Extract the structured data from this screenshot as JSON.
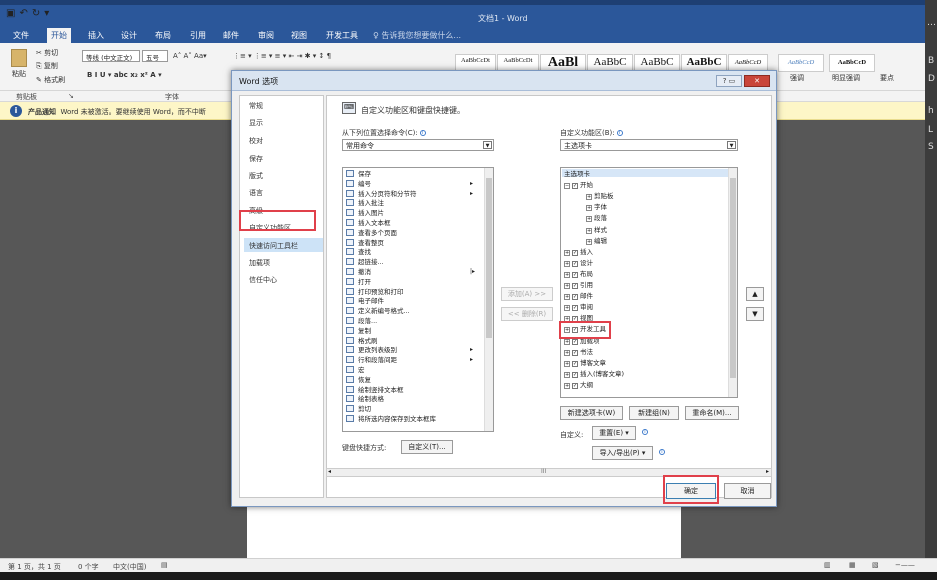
{
  "word": {
    "title": "文档1 - Word",
    "tabs": [
      "文件",
      "开始",
      "插入",
      "设计",
      "布局",
      "引用",
      "邮件",
      "审阅",
      "视图",
      "开发工具"
    ],
    "tell_me": "告诉我您想要做什么...",
    "clipboard": {
      "paste": "粘贴",
      "cut": "剪切",
      "copy": "复制",
      "format_painter": "格式刷"
    },
    "font_name": "等线 (中文正文)",
    "font_size": "五号",
    "styles": [
      "AaBbCcDt",
      "AaBbCcDt",
      "AaBl",
      "AaBbC",
      "AaBbC",
      "AaBbC",
      "AaBbCcD",
      "AaBbCcD",
      "AaBbCcD"
    ],
    "style_names": [
      "强调",
      "明显强调",
      "要点"
    ],
    "group_labels": [
      "剪贴板",
      "字体"
    ],
    "notice": {
      "label": "产品通知",
      "text": "Word 未被激活。要继续使用 Word，而不中断"
    },
    "status": {
      "page": "第 1 页，共 1 页",
      "words": "0 个字",
      "lang": "中文(中国)"
    },
    "right_panel": [
      "…",
      "B",
      "D",
      "h",
      "L",
      "S"
    ]
  },
  "dialog": {
    "title": "Word 选项",
    "nav": [
      "常规",
      "显示",
      "校对",
      "保存",
      "版式",
      "语言",
      "高级",
      "自定义功能区",
      "快速访问工具栏",
      "加载项",
      "信任中心"
    ],
    "selected_nav": "自定义功能区",
    "header": "自定义功能区和键盘快捷键。",
    "left_label": "从下列位置选择命令(C):",
    "left_select": "常用命令",
    "right_label": "自定义功能区(B):",
    "right_select": "主选项卡",
    "commands": [
      "保存",
      "编号",
      "插入分页符和分节符",
      "插入批注",
      "插入图片",
      "插入文本框",
      "查看多个页面",
      "查看整页",
      "查找",
      "超链接...",
      "撤消",
      "打开",
      "打印预览和打印",
      "电子邮件",
      "定义新编号格式...",
      "段落...",
      "复制",
      "格式刷",
      "更改列表级别",
      "行和段落间距",
      "宏",
      "恢复",
      "绘制竖排文本框",
      "绘制表格",
      "剪切",
      "将所选内容保存到文本框库"
    ],
    "tree": [
      {
        "pm": "⊟",
        "check": true,
        "label": "主选项卡",
        "root": true
      },
      {
        "pm": "⊟",
        "check": true,
        "label": "开始"
      },
      {
        "pm": "⊞",
        "label": "剪贴板",
        "indent": 2
      },
      {
        "pm": "⊞",
        "label": "字体",
        "indent": 2
      },
      {
        "pm": "⊞",
        "label": "段落",
        "indent": 2
      },
      {
        "pm": "⊞",
        "label": "样式",
        "indent": 2
      },
      {
        "pm": "⊞",
        "label": "编辑",
        "indent": 2
      },
      {
        "pm": "⊞",
        "check": true,
        "label": "插入"
      },
      {
        "pm": "⊞",
        "check": true,
        "label": "设计"
      },
      {
        "pm": "⊞",
        "check": true,
        "label": "布局"
      },
      {
        "pm": "⊞",
        "check": true,
        "label": "引用"
      },
      {
        "pm": "⊞",
        "check": true,
        "label": "邮件"
      },
      {
        "pm": "⊞",
        "check": true,
        "label": "审阅"
      },
      {
        "pm": "⊞",
        "check": true,
        "label": "视图"
      },
      {
        "pm": "⊞",
        "check": true,
        "label": "开发工具"
      },
      {
        "pm": "⊞",
        "check": true,
        "label": "加载项"
      },
      {
        "pm": "⊞",
        "check": true,
        "label": "书法"
      },
      {
        "pm": "⊞",
        "check": true,
        "label": "博客文章"
      },
      {
        "pm": "⊞",
        "check": true,
        "label": "插入(博客文章)"
      },
      {
        "pm": "⊞",
        "check": true,
        "label": "大纲"
      }
    ],
    "add_btn": "添加(A) >>",
    "remove_btn": "<< 删除(R)",
    "new_tab_btn": "新建选项卡(W)",
    "new_group_btn": "新建组(N)",
    "rename_btn": "重命名(M)...",
    "customize_label": "自定义:",
    "reset_btn": "重置(E) ▾",
    "import_export_btn": "导入/导出(P) ▾",
    "shortcut_label": "键盘快捷方式:",
    "customize_btn": "自定义(T)...",
    "ok_btn": "确定",
    "cancel_btn": "取消",
    "hscroll_label": "III"
  },
  "colors": {
    "accent": "#2b579a",
    "highlight": "#e0404a"
  }
}
